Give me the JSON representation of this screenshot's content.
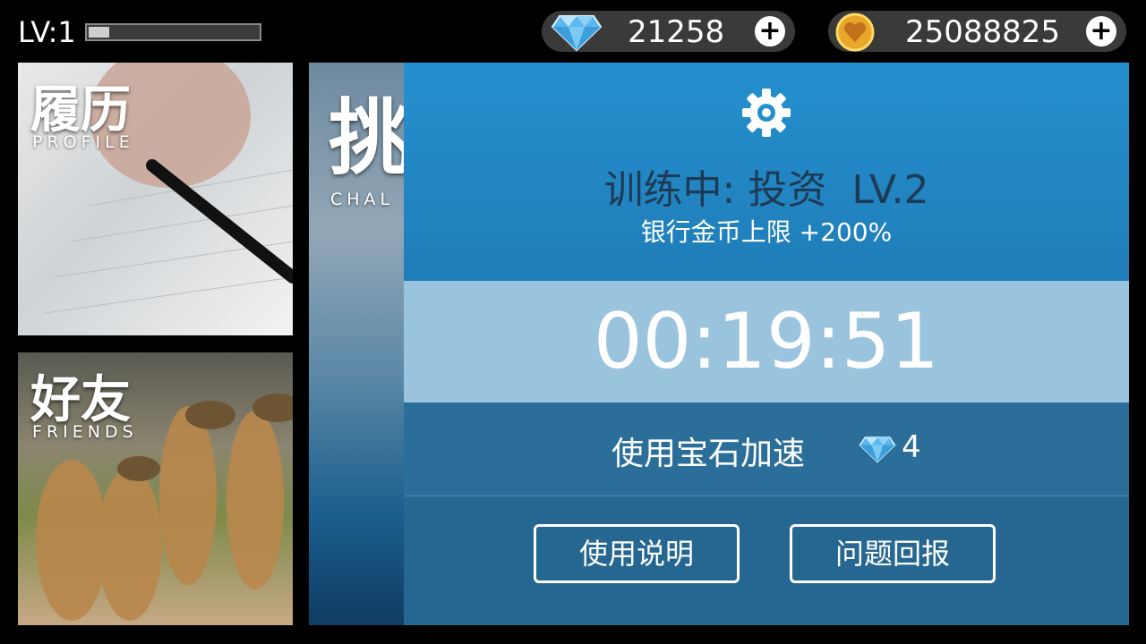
{
  "hud": {
    "level_label": "LV:1",
    "level_progress": 0.12,
    "gems": "21258",
    "coins": "25088825",
    "add_symbol": "+"
  },
  "tiles": {
    "profile": {
      "title": "履历",
      "subtitle": "PROFILE"
    },
    "friends": {
      "title": "好友",
      "subtitle": "FRIENDS"
    },
    "challenge": {
      "title": "挑",
      "subtitle": "CHAL"
    }
  },
  "training_panel": {
    "icon": "gear-icon",
    "title": "训练中: 投资  LV.2",
    "bonus": "银行金币上限 +200%",
    "timer": "00:19:51",
    "speedup_label": "使用宝石加速",
    "speedup_cost": "4",
    "help_button": "使用说明",
    "report_button": "问题回报"
  },
  "colors": {
    "panel_blue": "#2590cf",
    "timer_band": "#9ac4de",
    "title_dark": "#1f3a54"
  }
}
